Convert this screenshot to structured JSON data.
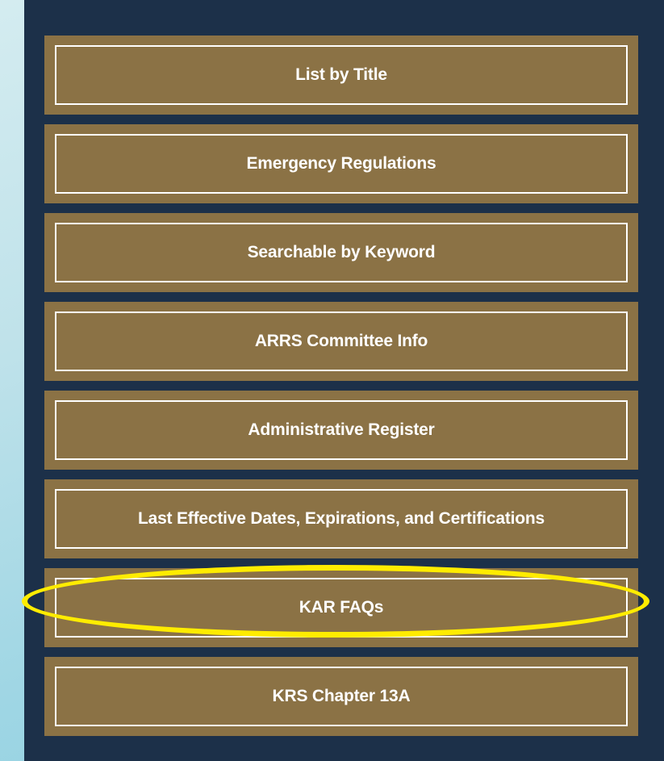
{
  "menu": {
    "items": [
      {
        "label": "List by Title"
      },
      {
        "label": "Emergency Regulations"
      },
      {
        "label": "Searchable by Keyword"
      },
      {
        "label": "ARRS Committee Info"
      },
      {
        "label": "Administrative Register"
      },
      {
        "label": "Last Effective Dates, Expirations, and Certifications"
      },
      {
        "label": "KAR FAQs"
      },
      {
        "label": "KRS Chapter 13A"
      }
    ]
  },
  "colors": {
    "panel_background": "#1c3049",
    "button_background": "#8b7245",
    "button_border": "#ffffff",
    "highlight_ring": "#ffec00"
  }
}
